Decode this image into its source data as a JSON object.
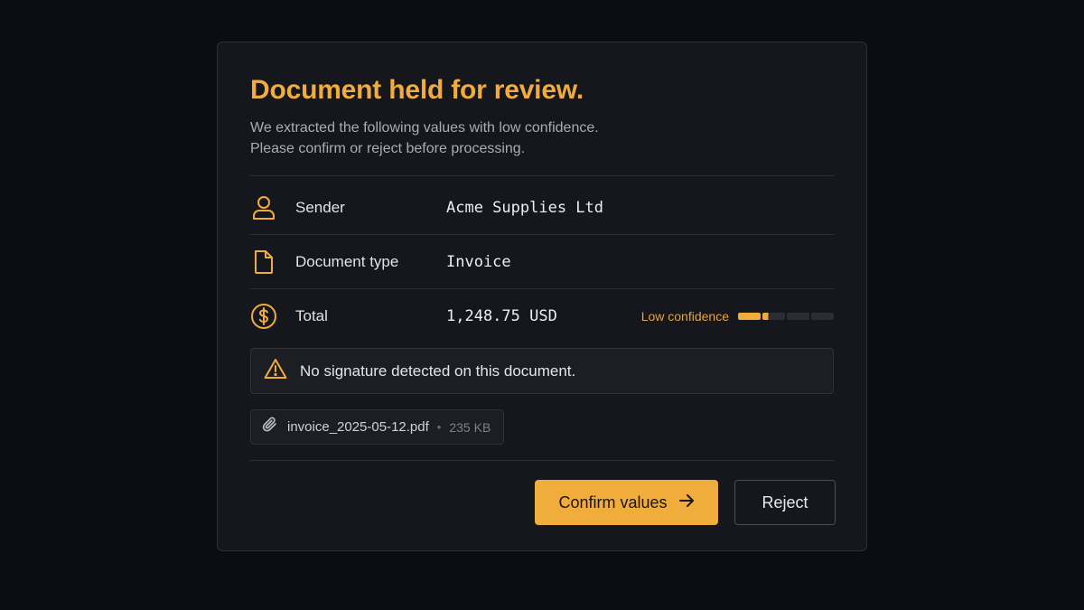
{
  "dialog": {
    "title": "Document held for review.",
    "subtitle_line1": "We extracted the following values with low confidence.",
    "subtitle_line2": "Please confirm or reject before processing."
  },
  "fields": [
    {
      "icon": "user-icon",
      "label": "Sender",
      "value": "Acme Supplies Ltd"
    },
    {
      "icon": "document-icon",
      "label": "Document type",
      "value": "Invoice"
    },
    {
      "icon": "dollar-icon",
      "label": "Total",
      "value": "1,248.75 USD",
      "confidence_label": "Low confidence",
      "confidence_level": 0.3
    }
  ],
  "warning": {
    "icon": "warning-icon",
    "text": "No signature detected on this document."
  },
  "attachment": {
    "icon": "paperclip-icon",
    "filename": "invoice_2025-05-12.pdf",
    "size": "235 KB"
  },
  "actions": {
    "confirm_label": "Confirm values",
    "reject_label": "Reject"
  },
  "colors": {
    "accent": "#f2ac3b",
    "background": "#0b0d12",
    "card": "#15171c"
  }
}
